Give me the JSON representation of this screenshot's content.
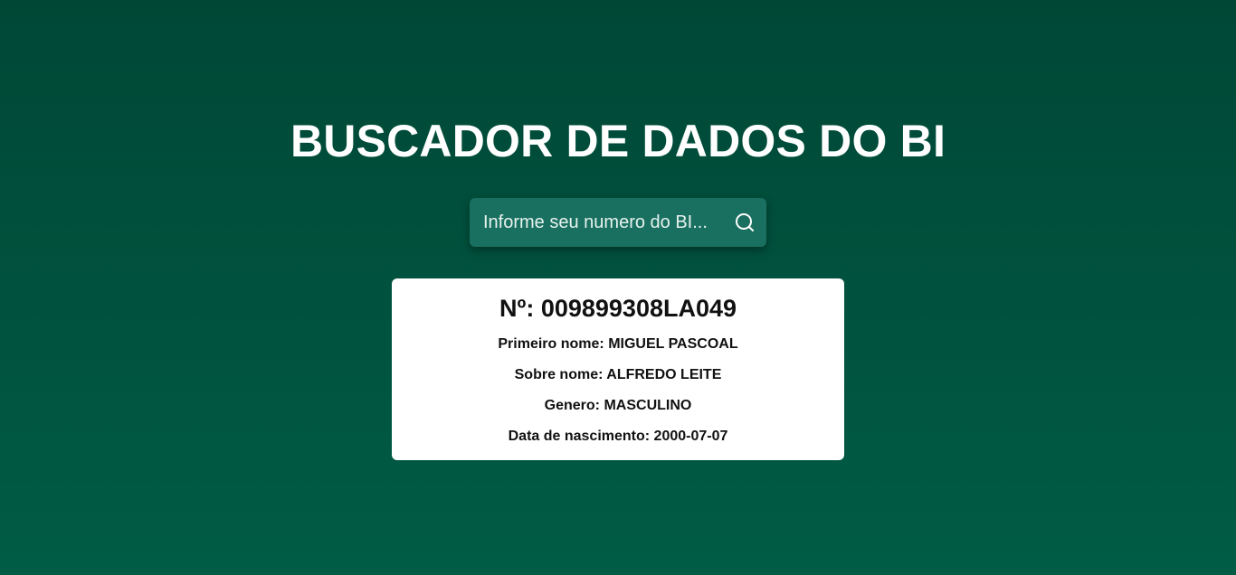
{
  "header": {
    "title": "BUSCADOR DE DADOS DO BI"
  },
  "search": {
    "placeholder": "Informe seu numero do BI...",
    "value": "",
    "icon": "search-icon"
  },
  "result": {
    "number_label": "Nº: ",
    "number": "009899308LA049",
    "fields": [
      {
        "label": "Primeiro nome: ",
        "value": "MIGUEL PASCOAL"
      },
      {
        "label": "Sobre nome: ",
        "value": "ALFREDO LEITE"
      },
      {
        "label": "Genero: ",
        "value": "MASCULINO"
      },
      {
        "label": "Data de nascimento: ",
        "value": "2000-07-07"
      }
    ]
  },
  "colors": {
    "background_top": "#004736",
    "background_bottom": "#005c45",
    "search_bg": "#1a7060",
    "card_bg": "#ffffff"
  }
}
